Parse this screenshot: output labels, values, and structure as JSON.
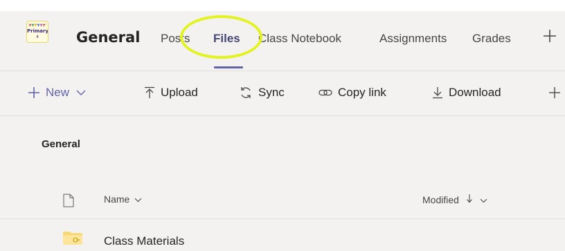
{
  "header": {
    "team_logo": {
      "icon": "class-team-logo-icon",
      "text": "Primary",
      "sub": "4"
    },
    "channel_title": "General",
    "tabs": [
      {
        "label": "Posts",
        "active": false
      },
      {
        "label": "Files",
        "active": true
      },
      {
        "label": "Class Notebook",
        "active": false
      },
      {
        "label": "Assignments",
        "active": false
      },
      {
        "label": "Grades",
        "active": false
      }
    ],
    "add_tab_icon": "plus-icon",
    "highlight_color": "#e3f31f"
  },
  "toolbar": {
    "new_label": "New",
    "upload_label": "Upload",
    "sync_label": "Sync",
    "copy_link_label": "Copy link",
    "download_label": "Download",
    "more_icon": "plus-icon"
  },
  "content": {
    "section_title": "General",
    "columns": {
      "name": "Name",
      "modified": "Modified"
    },
    "rows": [
      {
        "name": "Class Materials",
        "icon": "folder-icon"
      }
    ]
  },
  "colors": {
    "accent": "#6264a7",
    "folder": "#f8d775",
    "background": "#f3f2f1"
  }
}
